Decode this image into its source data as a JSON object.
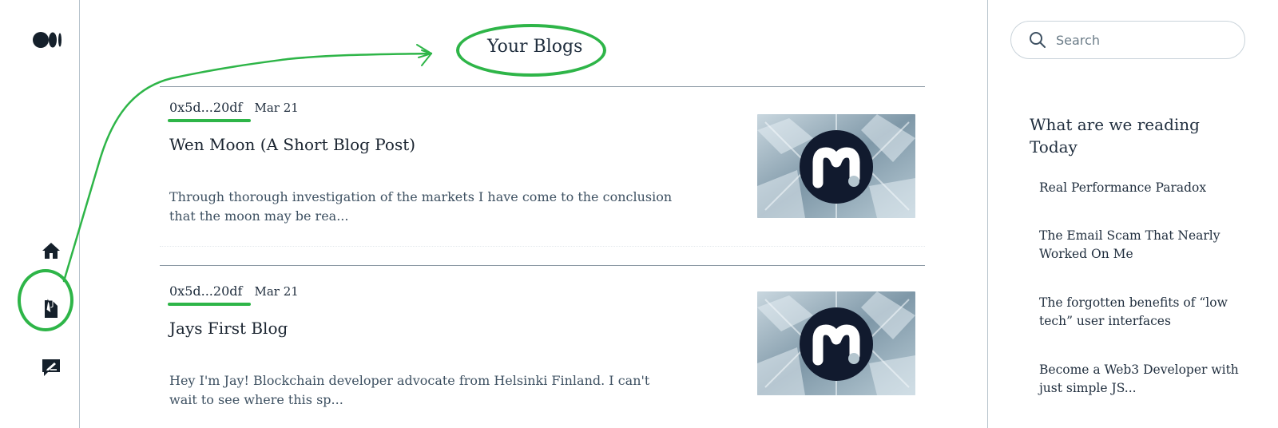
{
  "page": {
    "title": "Your Blogs"
  },
  "nav": {
    "logo_icon": "medium-logo-icon",
    "items": [
      {
        "name": "home",
        "icon": "home-icon"
      },
      {
        "name": "blogs",
        "icon": "blog-list-icon"
      },
      {
        "name": "write",
        "icon": "write-icon"
      }
    ]
  },
  "search": {
    "placeholder": "Search"
  },
  "blogs": [
    {
      "author": "0x5d...20df",
      "date": "Mar 21",
      "title": "Wen Moon (A Short Blog Post)",
      "excerpt": "Through thorough investigation of the markets I have come to the conclusion that the moon may be rea..."
    },
    {
      "author": "0x5d...20df",
      "date": "Mar 21",
      "title": "Jays First Blog",
      "excerpt": "Hey I'm Jay! Blockchain developer advocate from Helsinki Finland. I can't wait to see where this sp..."
    }
  ],
  "sidebar": {
    "heading": "What are we reading Today",
    "links": [
      "Real Performance Paradox",
      "The Email Scam That Nearly Worked On Me",
      "The forgotten benefits of “low tech” user interfaces",
      "Become a Web3 Developer with just simple JS..."
    ]
  },
  "colors": {
    "annotation": "#2eb548",
    "text": "#1f2d3d",
    "divider": "#8d9ba6"
  }
}
